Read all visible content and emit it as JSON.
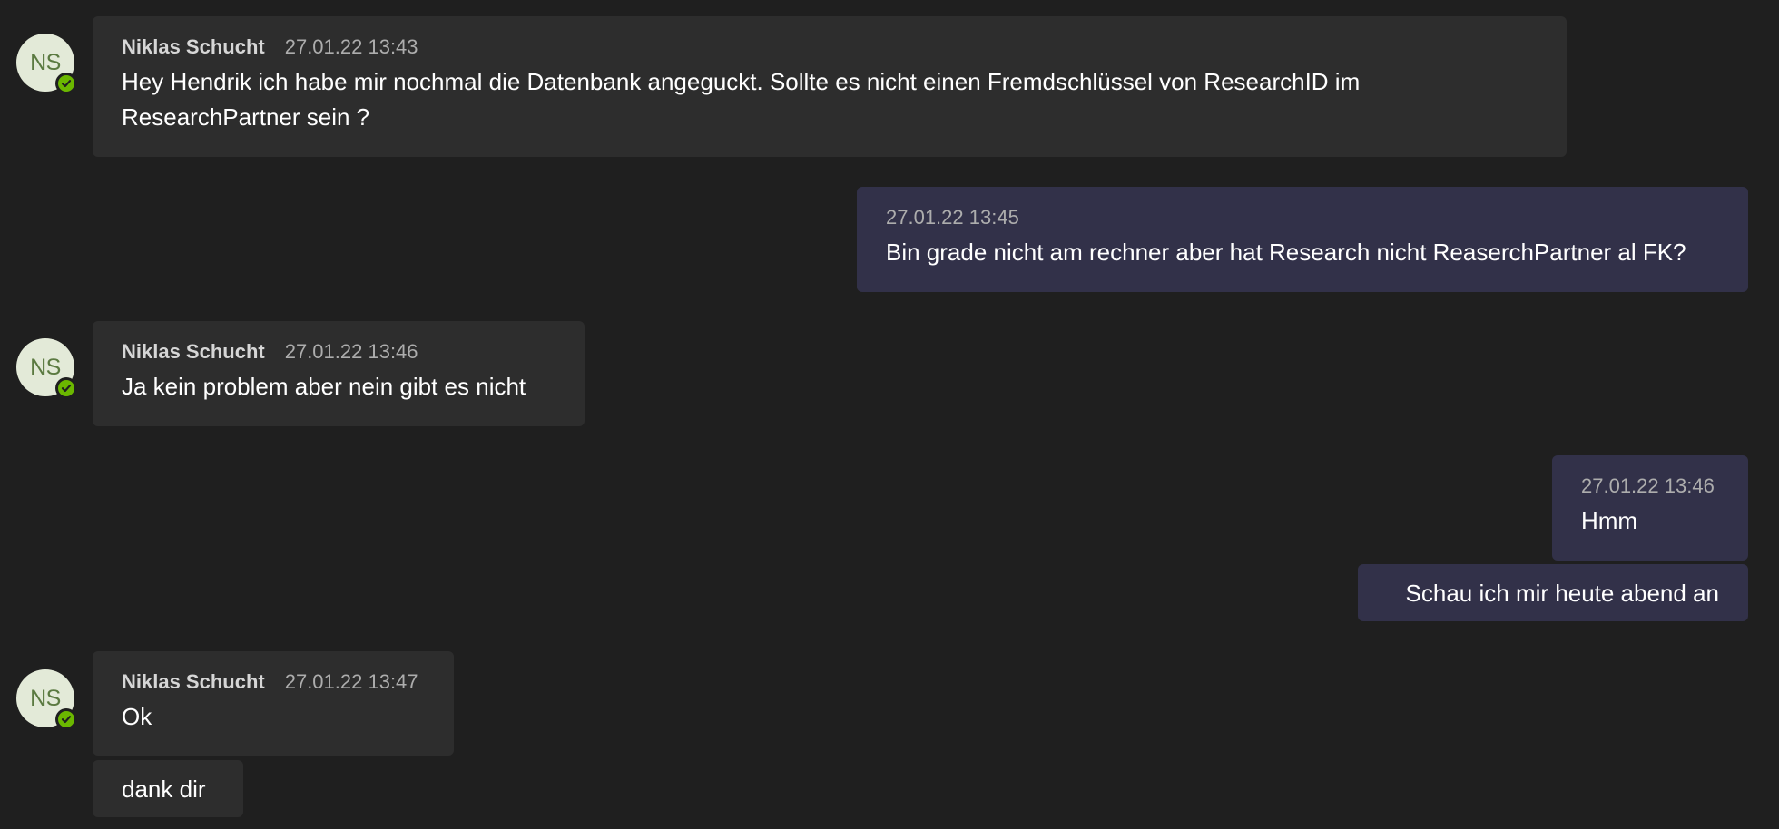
{
  "messages": [
    {
      "initials": "NS",
      "sender": "Niklas Schucht",
      "time": "27.01.22 13:43",
      "text_lines": [
        "Hey Hendrik ich habe mir nochmal die Datenbank angeguckt. Sollte es nicht einen Fremdschlüssel von ResearchID im",
        "ResearchPartner sein ?"
      ]
    },
    {
      "time": "27.01.22 13:45",
      "text": "Bin grade nicht am rechner aber hat Research nicht ReaserchPartner al FK?"
    },
    {
      "initials": "NS",
      "sender": "Niklas Schucht",
      "time": "27.01.22 13:46",
      "text": "Ja kein problem aber nein gibt es nicht"
    },
    {
      "time": "27.01.22 13:46",
      "text": "Hmm"
    },
    {
      "text": "Schau ich mir heute abend an"
    },
    {
      "initials": "NS",
      "sender": "Niklas Schucht",
      "time": "27.01.22 13:47",
      "text": "Ok"
    },
    {
      "text": "dank dir"
    }
  ],
  "colors": {
    "background": "#1f1f1f",
    "incoming_bubble": "#2d2d2d",
    "outgoing_bubble": "#323149",
    "avatar_bg": "#e3ead8",
    "avatar_text": "#5b7a41",
    "presence_available": "#6bb700"
  },
  "icons": {
    "presence": "available-check-icon"
  }
}
